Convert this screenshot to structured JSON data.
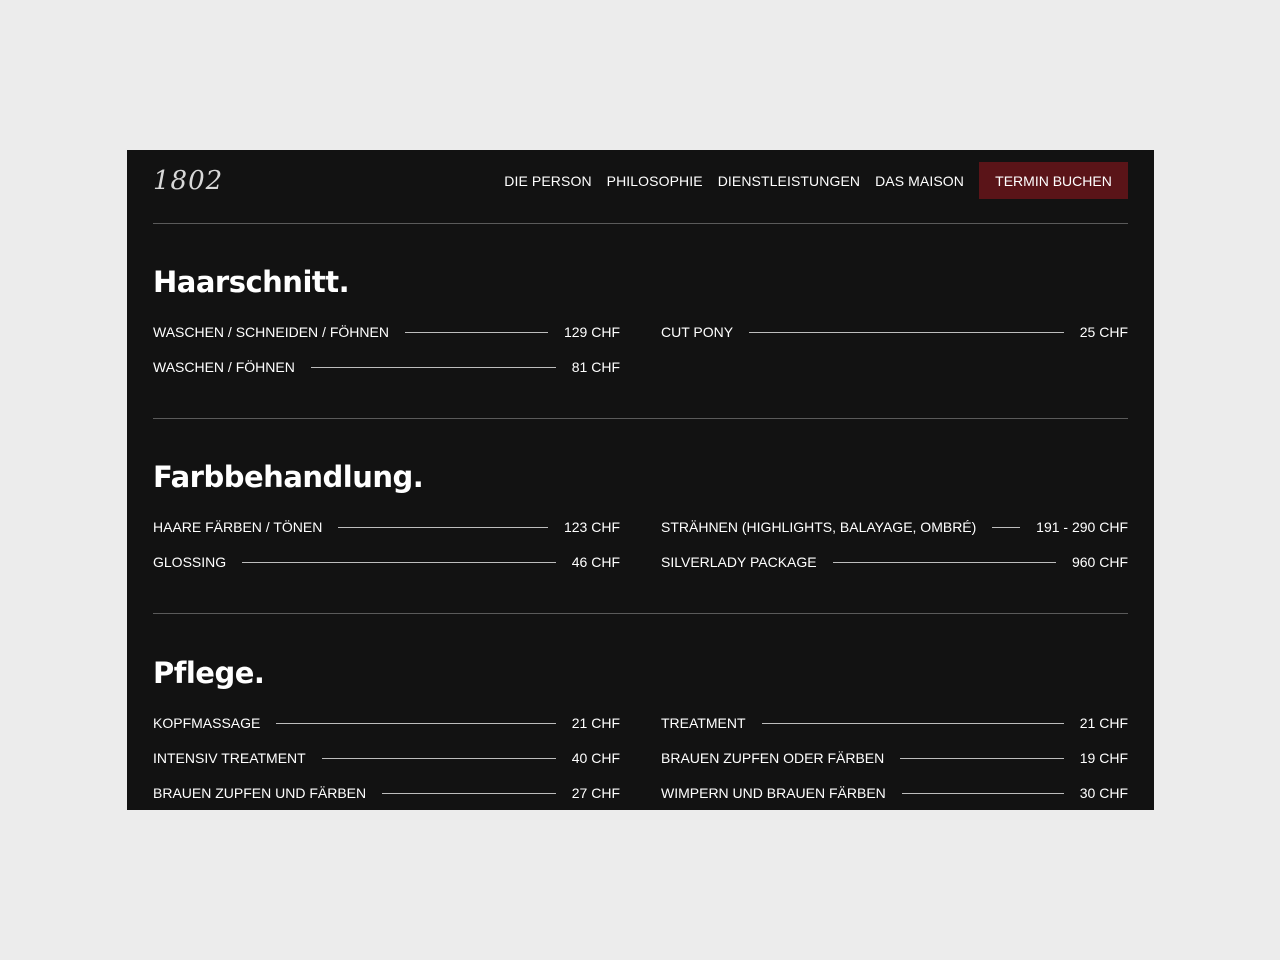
{
  "header": {
    "logo": "1802",
    "nav": [
      "DIE PERSON",
      "PHILOSOPHIE",
      "DIENSTLEISTUNGEN",
      "DAS MAISON"
    ],
    "cta": "TERMIN BUCHEN"
  },
  "colors": {
    "background": "#121212",
    "page": "#ececec",
    "accent": "#5a1418"
  },
  "sections": [
    {
      "title": "Haarschnitt.",
      "items": [
        {
          "name": "WASCHEN / SCHNEIDEN / FÖHNEN",
          "price": "129 CHF"
        },
        {
          "name": "CUT PONY",
          "price": "25 CHF"
        },
        {
          "name": "WASCHEN / FÖHNEN",
          "price": "81 CHF"
        }
      ]
    },
    {
      "title": "Farbbehandlung.",
      "items": [
        {
          "name": "HAARE FÄRBEN / TÖNEN",
          "price": "123 CHF"
        },
        {
          "name": "STRÄHNEN (HIGHLIGHTS, BALAYAGE, OMBRÉ)",
          "price": "191 - 290 CHF"
        },
        {
          "name": "GLOSSING",
          "price": "46 CHF"
        },
        {
          "name": "SILVERLADY PACKAGE",
          "price": "960 CHF"
        }
      ]
    },
    {
      "title": "Pflege.",
      "items": [
        {
          "name": "KOPFMASSAGE",
          "price": "21 CHF"
        },
        {
          "name": "TREATMENT",
          "price": "21 CHF"
        },
        {
          "name": "INTENSIV TREATMENT",
          "price": "40 CHF"
        },
        {
          "name": "BRAUEN ZUPFEN ODER FÄRBEN",
          "price": "19 CHF"
        },
        {
          "name": "BRAUEN ZUPFEN UND FÄRBEN",
          "price": "27 CHF"
        },
        {
          "name": "WIMPERN UND BRAUEN FÄRBEN",
          "price": "30 CHF"
        }
      ]
    }
  ]
}
